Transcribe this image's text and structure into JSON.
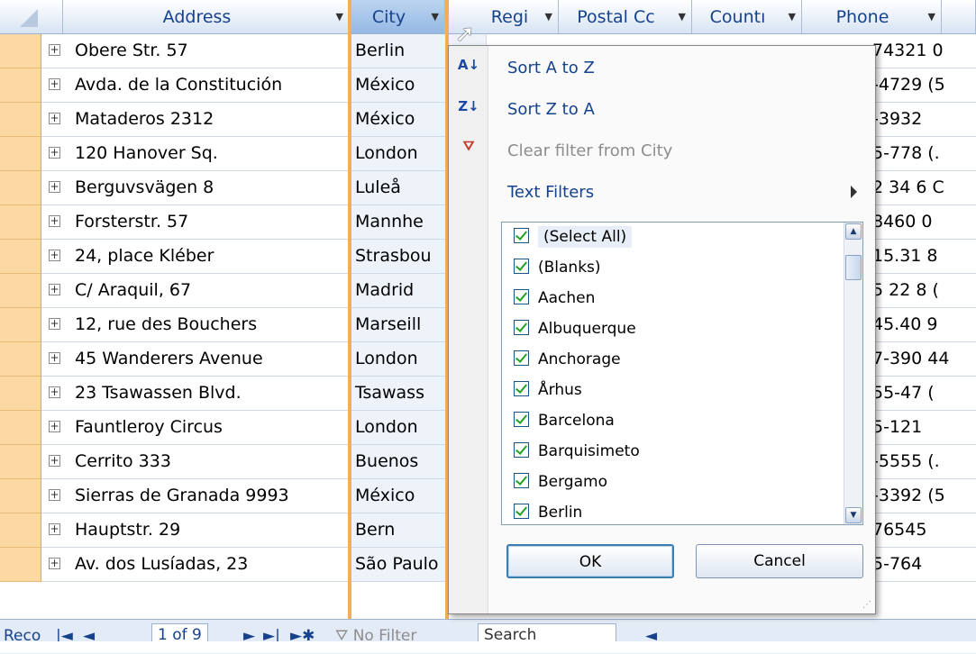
{
  "columns": {
    "address": "Address",
    "city": "City",
    "region": "Regi",
    "postal": "Postal Cc",
    "country": "Countı",
    "phone": "Phone"
  },
  "rows": [
    {
      "address": "Obere Str. 57",
      "city": "Berlin",
      "phone": "74321 0"
    },
    {
      "address": "Avda. de la Constitución",
      "city": "México",
      "phone": "-4729 (5"
    },
    {
      "address": "Mataderos  2312",
      "city": "México",
      "phone": "-3932"
    },
    {
      "address": "120 Hanover Sq.",
      "city": "London",
      "phone": "5-778 (."
    },
    {
      "address": "Berguvsvägen  8",
      "city": "Luleå",
      "phone": "2 34 6 C"
    },
    {
      "address": "Forsterstr. 57",
      "city": "Mannhe",
      "phone": "8460  0"
    },
    {
      "address": "24, place Kléber",
      "city": "Strasbou",
      "phone": "15.31  8"
    },
    {
      "address": "C/ Araquil, 67",
      "city": "Madrid",
      "phone": "5 22 8 ("
    },
    {
      "address": "12, rue des Bouchers",
      "city": "Marseill",
      "phone": "45.40  9"
    },
    {
      "address": "45 Wanderers Avenue",
      "city": "London",
      "phone": "7-390 44"
    },
    {
      "address": "23 Tsawassen Blvd.",
      "city": "Tsawass",
      "phone": "55-47 ("
    },
    {
      "address": "Fauntleroy Circus",
      "city": "London",
      "phone": "5-121"
    },
    {
      "address": "Cerrito 333",
      "city": "Buenos",
      "phone": "-5555 (."
    },
    {
      "address": "Sierras de Granada 9993",
      "city": "México",
      "phone": "-3392 (5"
    },
    {
      "address": "Hauptstr. 29",
      "city": "Bern",
      "phone": "76545"
    },
    {
      "address": "Av. dos Lusíadas, 23",
      "city": "São Paulo",
      "phone": "5-764"
    }
  ],
  "menu": {
    "sort_asc": "Sort A to Z",
    "sort_desc": "Sort Z to A",
    "clear_filter": "Clear filter from City",
    "text_filters": "Text Filters",
    "list": [
      "(Select All)",
      "(Blanks)",
      "Aachen",
      "Albuquerque",
      "Anchorage",
      "Århus",
      "Barcelona",
      "Barquisimeto",
      "Bergamo",
      "Berlin"
    ],
    "ok": "OK",
    "cancel": "Cancel"
  },
  "status": {
    "record": "Reco",
    "nav": "1 of 9",
    "no_filter": "No Filter",
    "search": "Search"
  },
  "icons": {
    "sort_asc": "sort-az-icon",
    "sort_desc": "sort-za-icon",
    "clear": "clear-filter-icon",
    "expand": "expand-icon",
    "dropdown": "dropdown-arrow-icon"
  }
}
